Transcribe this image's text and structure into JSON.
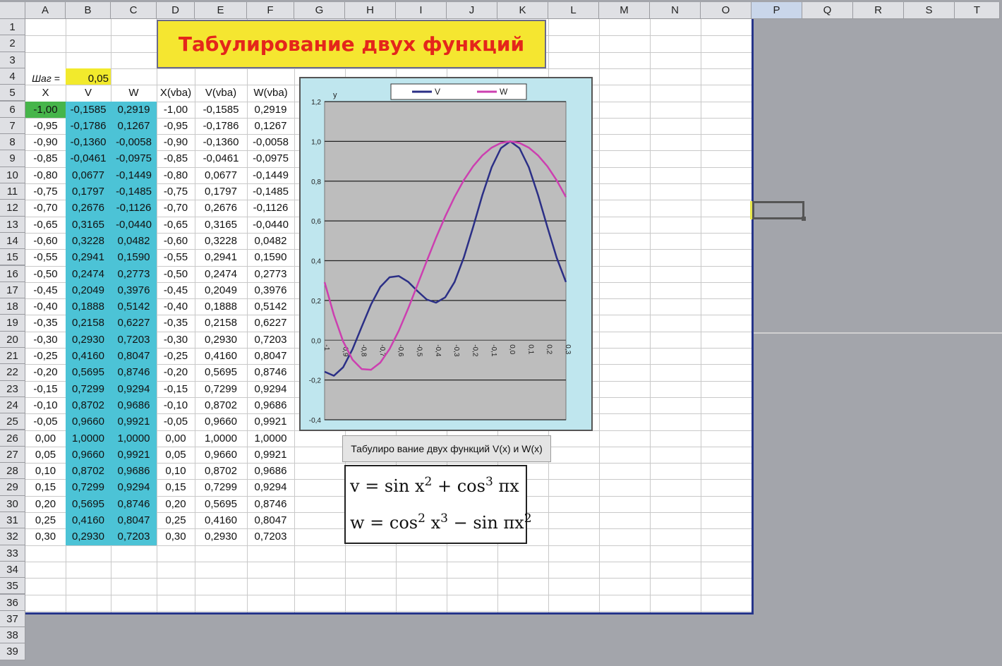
{
  "columns": [
    "A",
    "B",
    "C",
    "D",
    "E",
    "F",
    "G",
    "H",
    "I",
    "J",
    "K",
    "L",
    "M",
    "N",
    "O",
    "P",
    "Q",
    "R",
    "S",
    "T"
  ],
  "rows": [
    "1",
    "2",
    "3",
    "4",
    "5",
    "6",
    "7",
    "8",
    "9",
    "10",
    "11",
    "12",
    "13",
    "14",
    "15",
    "16",
    "17",
    "18",
    "19",
    "20",
    "21",
    "22",
    "23",
    "24",
    "25",
    "26",
    "27",
    "28",
    "29",
    "30",
    "31",
    "32",
    "33",
    "34",
    "35",
    "36",
    "37",
    "38",
    "39"
  ],
  "title": "Табулирование двух функций",
  "step": {
    "label": "Шаг =",
    "value": "0,05"
  },
  "table": {
    "headers": [
      "X",
      "V",
      "W",
      "X(vba)",
      "V(vba)",
      "W(vba)"
    ],
    "rows": [
      [
        "-1,00",
        "-0,1585",
        "0,2919",
        "-1,00",
        "-0,1585",
        "0,2919"
      ],
      [
        "-0,95",
        "-0,1786",
        "0,1267",
        "-0,95",
        "-0,1786",
        "0,1267"
      ],
      [
        "-0,90",
        "-0,1360",
        "-0,0058",
        "-0,90",
        "-0,1360",
        "-0,0058"
      ],
      [
        "-0,85",
        "-0,0461",
        "-0,0975",
        "-0,85",
        "-0,0461",
        "-0,0975"
      ],
      [
        "-0,80",
        "0,0677",
        "-0,1449",
        "-0,80",
        "0,0677",
        "-0,1449"
      ],
      [
        "-0,75",
        "0,1797",
        "-0,1485",
        "-0,75",
        "0,1797",
        "-0,1485"
      ],
      [
        "-0,70",
        "0,2676",
        "-0,1126",
        "-0,70",
        "0,2676",
        "-0,1126"
      ],
      [
        "-0,65",
        "0,3165",
        "-0,0440",
        "-0,65",
        "0,3165",
        "-0,0440"
      ],
      [
        "-0,60",
        "0,3228",
        "0,0482",
        "-0,60",
        "0,3228",
        "0,0482"
      ],
      [
        "-0,55",
        "0,2941",
        "0,1590",
        "-0,55",
        "0,2941",
        "0,1590"
      ],
      [
        "-0,50",
        "0,2474",
        "0,2773",
        "-0,50",
        "0,2474",
        "0,2773"
      ],
      [
        "-0,45",
        "0,2049",
        "0,3976",
        "-0,45",
        "0,2049",
        "0,3976"
      ],
      [
        "-0,40",
        "0,1888",
        "0,5142",
        "-0,40",
        "0,1888",
        "0,5142"
      ],
      [
        "-0,35",
        "0,2158",
        "0,6227",
        "-0,35",
        "0,2158",
        "0,6227"
      ],
      [
        "-0,30",
        "0,2930",
        "0,7203",
        "-0,30",
        "0,2930",
        "0,7203"
      ],
      [
        "-0,25",
        "0,4160",
        "0,8047",
        "-0,25",
        "0,4160",
        "0,8047"
      ],
      [
        "-0,20",
        "0,5695",
        "0,8746",
        "-0,20",
        "0,5695",
        "0,8746"
      ],
      [
        "-0,15",
        "0,7299",
        "0,9294",
        "-0,15",
        "0,7299",
        "0,9294"
      ],
      [
        "-0,10",
        "0,8702",
        "0,9686",
        "-0,10",
        "0,8702",
        "0,9686"
      ],
      [
        "-0,05",
        "0,9660",
        "0,9921",
        "-0,05",
        "0,9660",
        "0,9921"
      ],
      [
        "0,00",
        "1,0000",
        "1,0000",
        "0,00",
        "1,0000",
        "1,0000"
      ],
      [
        "0,05",
        "0,9660",
        "0,9921",
        "0,05",
        "0,9660",
        "0,9921"
      ],
      [
        "0,10",
        "0,8702",
        "0,9686",
        "0,10",
        "0,8702",
        "0,9686"
      ],
      [
        "0,15",
        "0,7299",
        "0,9294",
        "0,15",
        "0,7299",
        "0,9294"
      ],
      [
        "0,20",
        "0,5695",
        "0,8746",
        "0,20",
        "0,5695",
        "0,8746"
      ],
      [
        "0,25",
        "0,4160",
        "0,8047",
        "0,25",
        "0,4160",
        "0,8047"
      ],
      [
        "0,30",
        "0,2930",
        "0,7203",
        "0,30",
        "0,2930",
        "0,7203"
      ]
    ]
  },
  "chart_button_label": "Табулиро вание двух функций V(x) и W(x)",
  "formulas": {
    "v": {
      "lhs": "v = sin x",
      "e1": "2",
      "mid": " + cos",
      "e2": "3",
      "rhs": " πx"
    },
    "w": {
      "lhs": "w = cos",
      "e1": "2",
      "mid": " x",
      "e2": "3",
      "rhs": " − sin πx",
      "e3": "2"
    }
  },
  "chart_data": {
    "type": "line",
    "title": "",
    "xlabel": "",
    "ylabel": "y",
    "x": [
      "-1",
      "-0,9",
      "-0,8",
      "-0,7",
      "-0,6",
      "-0,5",
      "-0,4",
      "-0,3",
      "-0,2",
      "-0,1",
      "0,0",
      "0,1",
      "0,2",
      "0,3"
    ],
    "ylim": [
      -0.4,
      1.2
    ],
    "yticks": [
      "1,2",
      "1,0",
      "0,8",
      "0,6",
      "0,4",
      "0,2",
      "0,0",
      "-0,2",
      "-0,4"
    ],
    "legend_position": "top",
    "grid": true,
    "series": [
      {
        "name": "V",
        "color": "#2b2f86",
        "values": [
          -0.1585,
          -0.1786,
          -0.136,
          -0.0461,
          0.0677,
          0.1797,
          0.2676,
          0.3165,
          0.3228,
          0.2941,
          0.2474,
          0.2049,
          0.1888,
          0.2158,
          0.293,
          0.416,
          0.5695,
          0.7299,
          0.8702,
          0.966,
          1.0,
          0.966,
          0.8702,
          0.7299,
          0.5695,
          0.416,
          0.293
        ]
      },
      {
        "name": "W",
        "color": "#cc3fb0",
        "values": [
          0.2919,
          0.1267,
          -0.0058,
          -0.0975,
          -0.1449,
          -0.1485,
          -0.1126,
          -0.044,
          0.0482,
          0.159,
          0.2773,
          0.3976,
          0.5142,
          0.6227,
          0.7203,
          0.8047,
          0.8746,
          0.9294,
          0.9686,
          0.9921,
          1.0,
          0.9921,
          0.9686,
          0.9294,
          0.8746,
          0.8047,
          0.7203
        ]
      }
    ]
  }
}
